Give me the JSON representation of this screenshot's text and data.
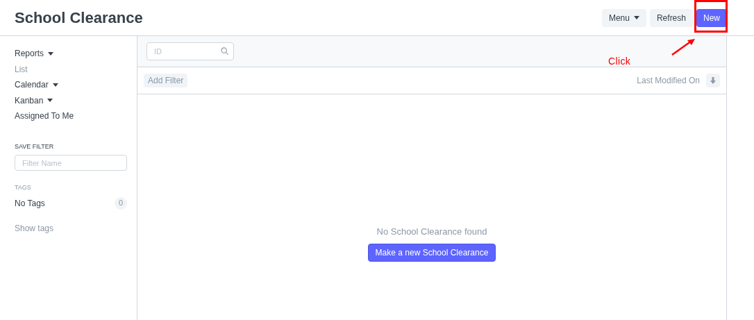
{
  "page": {
    "title": "School Clearance"
  },
  "actions": [
    {
      "label": "Menu",
      "kind": "dropdown"
    },
    {
      "label": "Refresh",
      "kind": "default"
    },
    {
      "label": "New",
      "kind": "primary"
    }
  ],
  "annotation": {
    "label": "Click"
  },
  "sidebar": {
    "items": [
      {
        "label": "Reports",
        "caret": true,
        "selected": false
      },
      {
        "label": "List",
        "caret": false,
        "selected": true
      },
      {
        "label": "Calendar",
        "caret": true,
        "selected": false
      },
      {
        "label": "Kanban",
        "caret": true,
        "selected": false
      },
      {
        "label": "Assigned To Me",
        "caret": false,
        "selected": false
      }
    ],
    "save_filter": {
      "heading": "SAVE FILTER",
      "placeholder": "Filter Name"
    },
    "tags": {
      "heading": "TAGS",
      "label": "No Tags",
      "count": "0",
      "link": "Show tags"
    }
  },
  "list": {
    "search": {
      "placeholder": "ID"
    },
    "add_filter": "Add Filter",
    "sort": "Last Modified On",
    "empty": {
      "message": "No School Clearance found",
      "button": "Make a new School Clearance"
    }
  }
}
